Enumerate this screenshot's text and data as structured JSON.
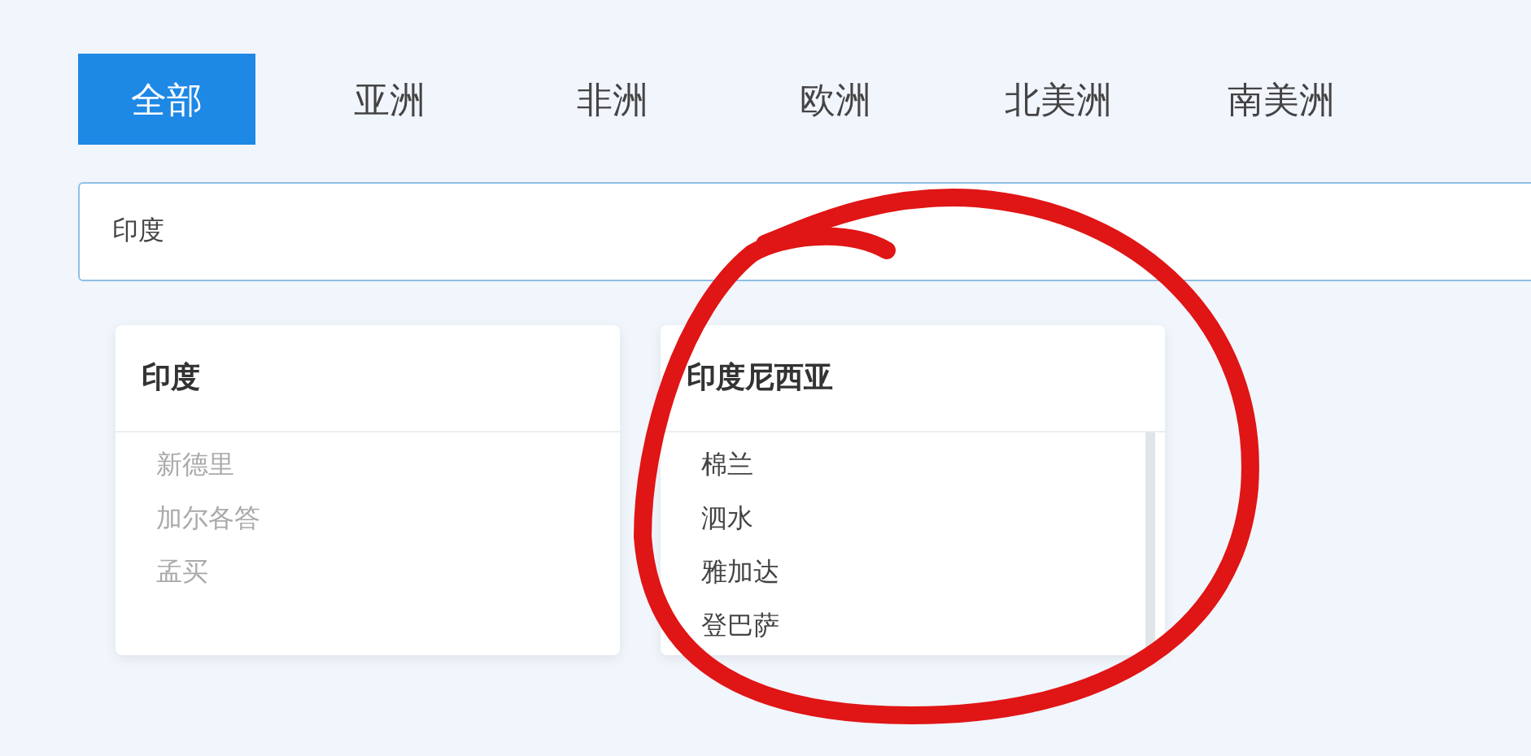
{
  "tabs": [
    {
      "label": "全部",
      "selected": true
    },
    {
      "label": "亚洲",
      "selected": false
    },
    {
      "label": "非洲",
      "selected": false
    },
    {
      "label": "欧洲",
      "selected": false
    },
    {
      "label": "北美洲",
      "selected": false
    },
    {
      "label": "南美洲",
      "selected": false
    }
  ],
  "search": {
    "value": "印度"
  },
  "cards": [
    {
      "title": "印度",
      "muted": true,
      "scrollable": false,
      "cities": [
        "新德里",
        "加尔各答",
        "孟买"
      ]
    },
    {
      "title": "印度尼西亚",
      "muted": false,
      "scrollable": true,
      "cities": [
        "棉兰",
        "泗水",
        "雅加达",
        "登巴萨"
      ]
    }
  ],
  "annotation": {
    "kind": "circle",
    "color": "#e01515"
  }
}
